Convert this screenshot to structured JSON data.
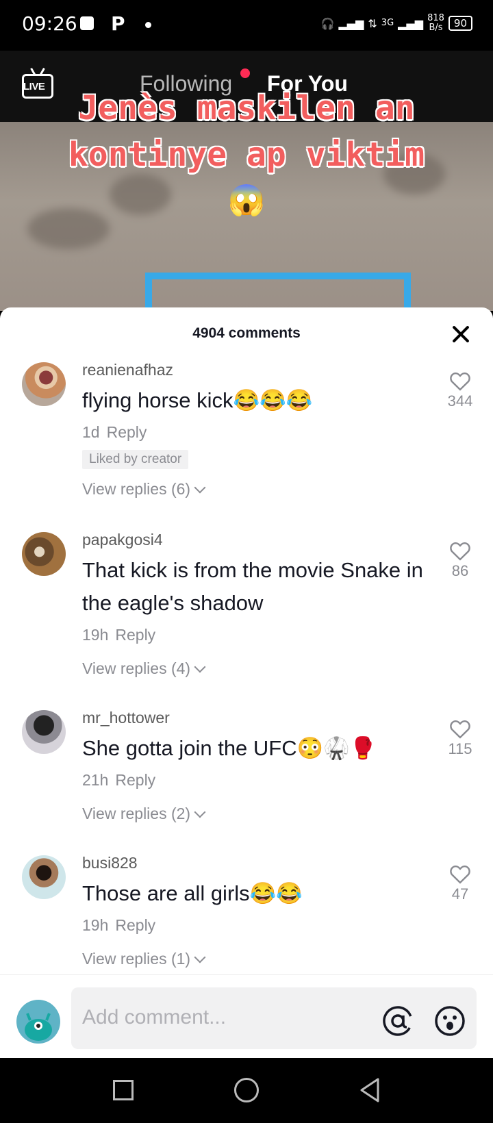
{
  "status_bar": {
    "time": "09:26",
    "network": "3G",
    "speed_value": "818",
    "speed_unit": "B/s",
    "battery": "90"
  },
  "top_nav": {
    "live_label": "LIVE",
    "following_label": "Following",
    "for_you_label": "For You"
  },
  "video": {
    "caption_line1": "Jenès maskilen an",
    "caption_line2": "kontinye ap viktim",
    "caption_emoji": "😱"
  },
  "comments_sheet": {
    "title": "4904 comments",
    "comments": [
      {
        "username": "reanienafhaz",
        "text": "flying horse kick😂😂😂",
        "time": "1d",
        "reply_label": "Reply",
        "badge": "Liked by creator",
        "view_replies": "View replies (6)",
        "likes": "344"
      },
      {
        "username": "papakgosi4",
        "text": "That kick is from the movie Snake in the eagle's shadow",
        "time": "19h",
        "reply_label": "Reply",
        "view_replies": "View replies (4)",
        "likes": "86"
      },
      {
        "username": "mr_hottower",
        "text": "She gotta join the UFC😳🥋🥊",
        "time": "21h",
        "reply_label": "Reply",
        "view_replies": "View replies (2)",
        "likes": "115"
      },
      {
        "username": "busi828",
        "text": "Those are all girls😂😂",
        "time": "19h",
        "reply_label": "Reply",
        "view_replies": "View replies (1)",
        "likes": "47"
      }
    ]
  },
  "comment_input": {
    "placeholder": "Add comment..."
  },
  "colors": {
    "accent": "#fe2c55",
    "caption": "#f25e5e",
    "secondary_text": "#8a8b91"
  }
}
